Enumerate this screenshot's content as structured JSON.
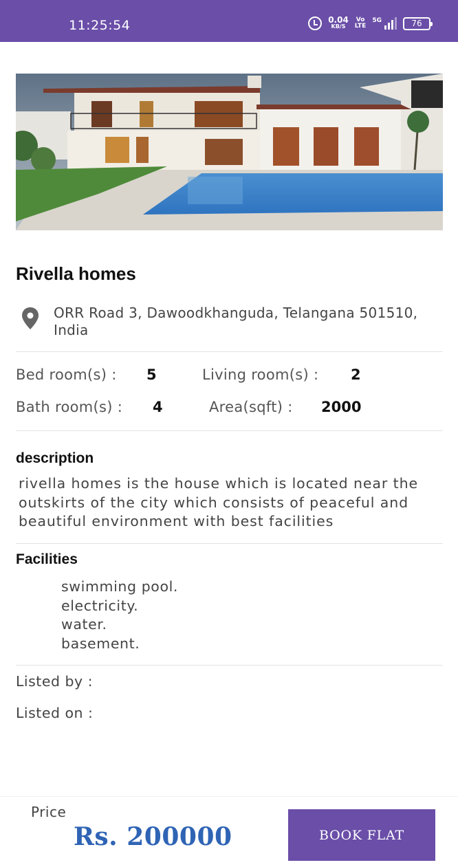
{
  "status_bar": {
    "time": "11:25:54",
    "speed_value": "0.04",
    "speed_unit": "KB/S",
    "volte_top": "Vo",
    "volte_bottom": "LTE",
    "network": "5G",
    "battery": "76"
  },
  "property": {
    "title": "Rivella homes",
    "address": "ORR Road 3, Dawoodkhanguda, Telangana 501510, India"
  },
  "specs": {
    "bedrooms_label": "Bed room(s) :",
    "bedrooms_value": "5",
    "living_label": "Living room(s) :",
    "living_value": "2",
    "bathrooms_label": "Bath room(s) :",
    "bathrooms_value": "4",
    "area_label": "Area(sqft) :",
    "area_value": "2000"
  },
  "description": {
    "heading": "description",
    "text": "rivella homes is the house which is located near the outskirts of the city which consists of peaceful and beautiful environment with best facilities"
  },
  "facilities": {
    "heading": "Facilities",
    "items": [
      "swimming pool.",
      "electricity.",
      "water.",
      "basement."
    ]
  },
  "listing": {
    "listed_by_label": "Listed by :",
    "listed_on_label": "Listed on :"
  },
  "footer": {
    "price_label": "Price",
    "price_value": "Rs. 200000",
    "book_button": "BOOK FLAT"
  },
  "colors": {
    "accent": "#6a4ea8",
    "price": "#2f64b5"
  },
  "icons": [
    "alarm-icon",
    "signal-icon",
    "battery-icon",
    "location-pin-icon"
  ]
}
